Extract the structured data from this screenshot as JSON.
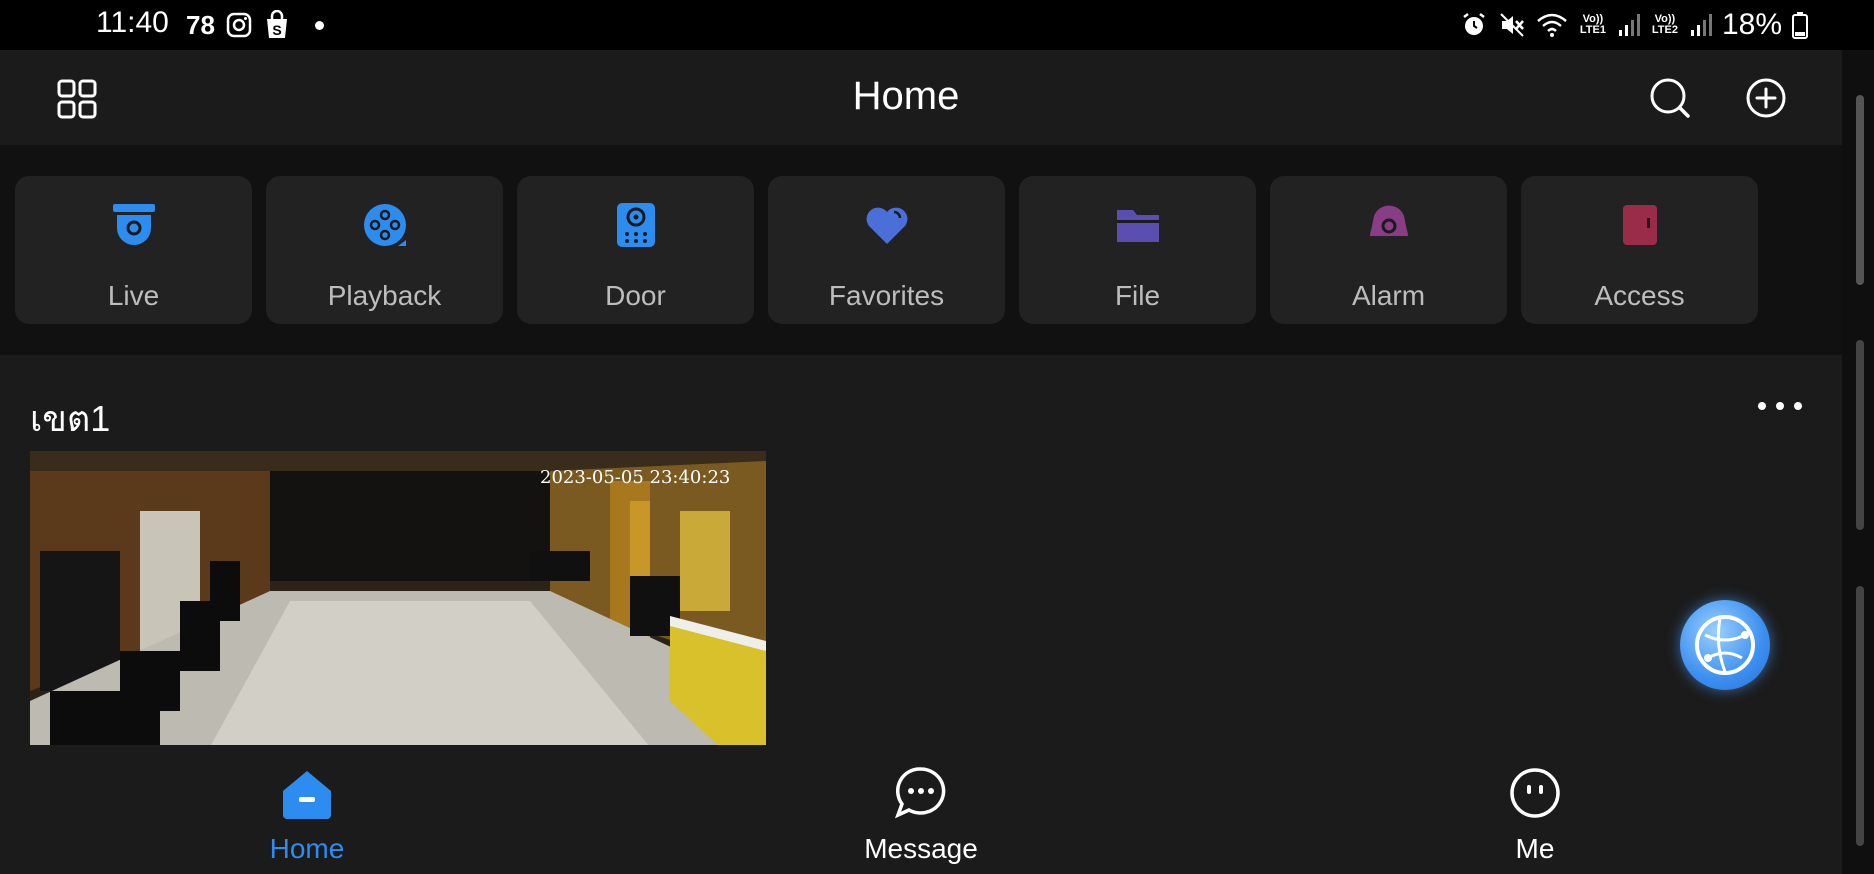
{
  "status_bar": {
    "time": "11:40",
    "notification_count": "78",
    "network_1": "Vo)) LTE1",
    "network_2": "Vo)) LTE2",
    "battery": "18%"
  },
  "app_bar": {
    "title": "Home"
  },
  "quick_actions": [
    {
      "label": "Live",
      "icon": "camera-dome-icon",
      "color": "#2d8cf0"
    },
    {
      "label": "Playback",
      "icon": "playback-reel-icon",
      "color": "#2d8cf0"
    },
    {
      "label": "Door",
      "icon": "door-intercom-icon",
      "color": "#2d8cf0"
    },
    {
      "label": "Favorites",
      "icon": "heart-icon",
      "color": "#4a6fd8"
    },
    {
      "label": "File",
      "icon": "folder-icon",
      "color": "#5a4fb0"
    },
    {
      "label": "Alarm",
      "icon": "alarm-siren-icon",
      "color": "#8a3d87"
    },
    {
      "label": "Access",
      "icon": "access-door-icon",
      "color": "#9a2c4a"
    }
  ],
  "group": {
    "title": "เขต1",
    "camera_timestamp": "2023-05-05 23:40:23"
  },
  "bottom_nav": {
    "home": "Home",
    "message": "Message",
    "me": "Me",
    "active_color": "#2d8cf0"
  }
}
